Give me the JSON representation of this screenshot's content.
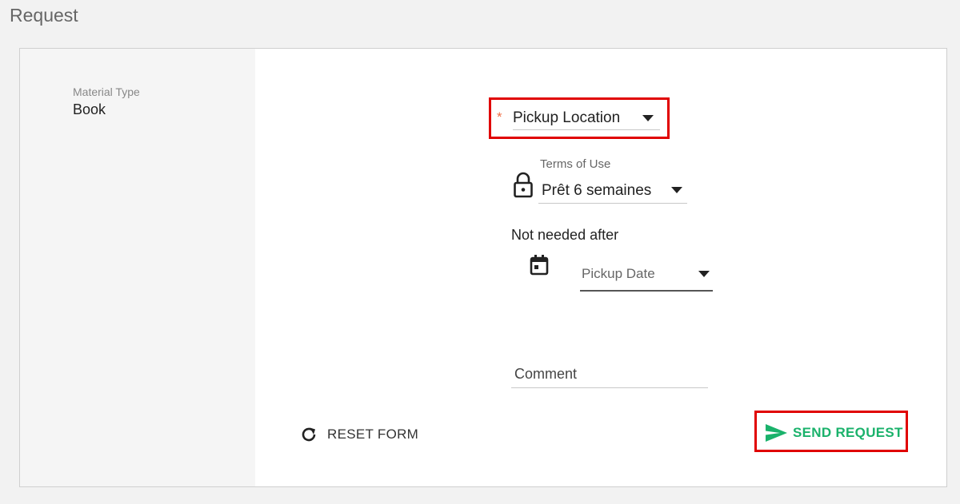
{
  "page": {
    "title": "Request"
  },
  "material": {
    "label": "Material Type",
    "value": "Book"
  },
  "pickup": {
    "placeholder": "Pickup Location",
    "required_mark": "*"
  },
  "terms": {
    "label": "Terms of Use",
    "value": "Prêt 6 semaines"
  },
  "not_needed": {
    "label": "Not needed after",
    "placeholder": "Pickup Date"
  },
  "comment": {
    "label": "Comment"
  },
  "actions": {
    "reset_label": "RESET FORM",
    "send_label": "SEND REQUEST"
  },
  "icons": {
    "lock": "lock-icon",
    "calendar": "calendar-icon",
    "reset": "refresh-icon",
    "send": "send-icon"
  },
  "colors": {
    "accent": "#1ab26b",
    "required": "#f07048",
    "highlight": "#e00000"
  }
}
